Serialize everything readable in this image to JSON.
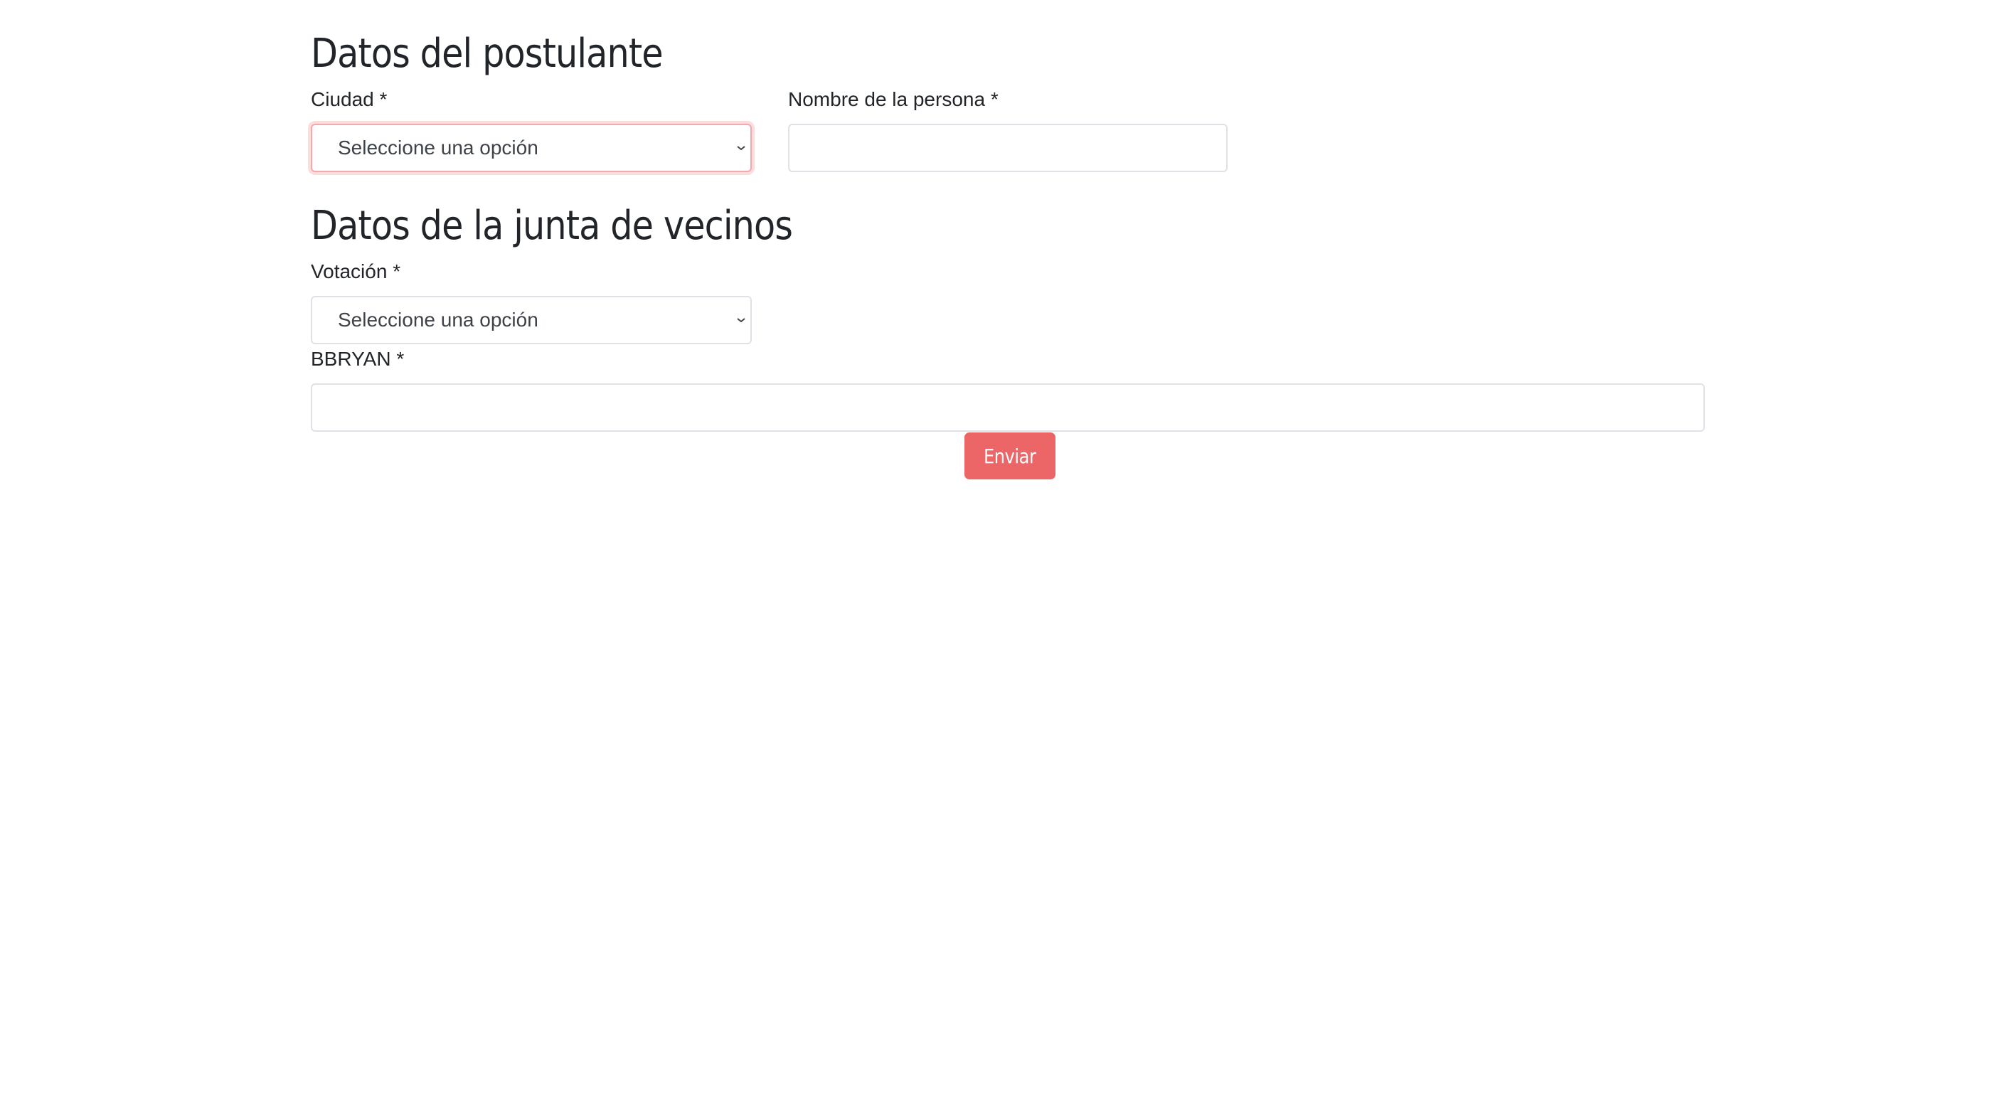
{
  "section_applicant": {
    "title": "Datos del postulante",
    "city_label": "Ciudad *",
    "city_select_value": "Seleccione una opción",
    "person_name_label": "Nombre de la persona *",
    "person_name_value": ""
  },
  "section_neighborhood": {
    "title": "Datos de la junta de vecinos",
    "vote_label": "Votación *",
    "vote_select_value": "Seleccione una opción",
    "bbryan_label": "BBRYAN *",
    "bbryan_value": ""
  },
  "submit_label": "Enviar",
  "colors": {
    "accent": "#ec6567",
    "focus_ring": "#f1a9ac",
    "border": "#dee2e6",
    "text": "#212529"
  }
}
